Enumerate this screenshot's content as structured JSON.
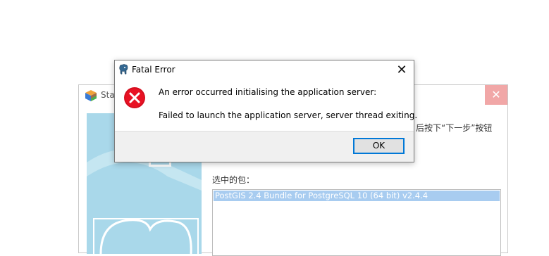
{
  "background_window": {
    "title": "Stac",
    "instruction_text": "后按下“下一步”按钮",
    "packages_label": "选中的包：",
    "packages": [
      "PostGIS 2.4 Bundle for PostgreSQL 10 (64 bit) v2.4.4"
    ],
    "close_label": "✕"
  },
  "dialog": {
    "title": "Fatal Error",
    "close_label": "✕",
    "message1": "An error occurred initialising the application server:",
    "message2": "Failed to launch the application server, server thread exiting.",
    "ok_label": "OK"
  },
  "icons": {
    "dialog_app": "postgres-elephant-icon",
    "error": "error-x-icon",
    "background_app": "stackbuilder-cube-icon"
  },
  "colors": {
    "error_red": "#e81123",
    "side_panel": "#a9d8ea",
    "selection": "#a8ccf0",
    "button_focus": "#0078d7",
    "bg_close": "#f1a7a7"
  }
}
